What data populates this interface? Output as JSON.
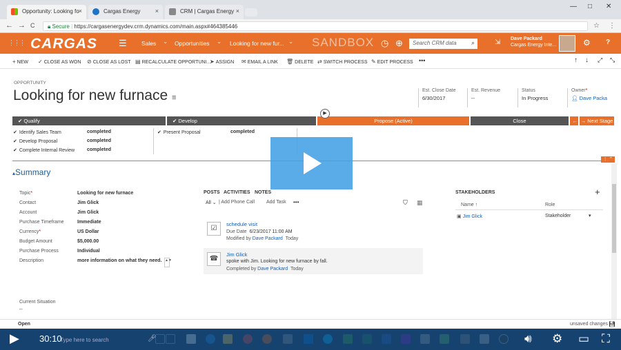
{
  "browser": {
    "tabs": [
      {
        "title": "Opportunity: Looking fo",
        "close": "×"
      },
      {
        "title": "Cargas Energy",
        "close": "×"
      },
      {
        "title": "CRM | Cargas Energy",
        "close": "×"
      }
    ],
    "secure_label": "Secure",
    "url": "https://cargasenergydev.crm.dynamics.com/main.aspx#464385446",
    "back": "←",
    "forward": "→",
    "reload": "C",
    "min": "—",
    "max": "□",
    "close": "✕",
    "star": "☆",
    "menu": "⋮"
  },
  "crmnav": {
    "logo": "CARGAS",
    "hamburger": "☰",
    "items": [
      "Sales",
      "Opportunities",
      "Looking for new fur..."
    ],
    "chevron": "⌄",
    "sandbox": "SANDBOX",
    "search_placeholder": "Search CRM data",
    "search_icon": "⌕",
    "user_name": "Dave Packard",
    "org_name": "Cargas Energy Inte...",
    "gear": "⚙",
    "help": "?",
    "clock": "◷",
    "plus": "⊕",
    "apps": "⋮⋮⋮"
  },
  "commands": [
    {
      "icon": "+",
      "label": "New"
    },
    {
      "icon": "✓",
      "label": "Close as Won"
    },
    {
      "icon": "⊘",
      "label": "Close as Lost"
    },
    {
      "icon": "▤",
      "label": "Recalculate Opportuni..."
    },
    {
      "icon": "➤",
      "label": "Assign"
    },
    {
      "icon": "✉",
      "label": "Email a Link"
    },
    {
      "icon": "🗑",
      "label": "Delete"
    },
    {
      "icon": "⇄",
      "label": "Switch Process"
    },
    {
      "icon": "✎",
      "label": "Edit Process"
    },
    {
      "icon": "•••",
      "label": ""
    }
  ],
  "header": {
    "entity": "OPPORTUNITY",
    "title": "Looking for new furnace",
    "fields": [
      {
        "label": "Est. Close Date",
        "value": "6/30/2017"
      },
      {
        "label": "Est. Revenue",
        "value": "--"
      },
      {
        "label": "Status",
        "value": "In Progress"
      },
      {
        "label": "Owner",
        "value": "Dave Packa"
      }
    ]
  },
  "process": {
    "stages": [
      "Qualify",
      "Develop",
      "Propose (Active)",
      "Close"
    ],
    "next_stage": "Next Stage",
    "qualify_steps": [
      {
        "name": "Identify Sales Team",
        "value": "completed"
      },
      {
        "name": "Develop Proposal",
        "value": "completed"
      },
      {
        "name": "Complete Internal Review",
        "value": "completed"
      }
    ],
    "develop_steps": [
      {
        "name": "Present Proposal",
        "value": "completed"
      }
    ]
  },
  "summary": {
    "title": "Summary",
    "fields": [
      {
        "label": "Topic",
        "value": "Looking for new furnace"
      },
      {
        "label": "Contact",
        "value": "Jim Glick"
      },
      {
        "label": "Account",
        "value": "Jim Glick"
      },
      {
        "label": "Purchase Timeframe",
        "value": "Immediate"
      },
      {
        "label": "Currency",
        "value": "US Dollar"
      },
      {
        "label": "Budget Amount",
        "value": "$5,000.00"
      },
      {
        "label": "Purchase Process",
        "value": "Individual"
      },
      {
        "label": "Description",
        "value": "more information on what they need."
      }
    ],
    "current_situation_label": "Current Situation",
    "current_situation_value": "--"
  },
  "activities": {
    "tabs": [
      "POSTS",
      "ACTIVITIES",
      "NOTES"
    ],
    "filter_all": "All",
    "add_phone": "Add Phone Call",
    "add_task": "Add Task",
    "more": "•••",
    "items": [
      {
        "title": "schedule visit",
        "line1_label": "Due Date",
        "line1_value": "6/23/2017 11:00 AM",
        "line2_label": "Modified by",
        "line2_person": "Dave Packard",
        "line2_when": "Today"
      },
      {
        "title": "Jim Glick",
        "line1_label": "",
        "line1_value": "spoke with Jim. Looking for new furnace by fall.",
        "line2_label": "Completed by",
        "line2_person": "Dave Packard",
        "line2_when": "Today"
      }
    ]
  },
  "stakeholders": {
    "title": "STAKEHOLDERS",
    "add": "+",
    "col_name": "Name",
    "col_role": "Role",
    "rows": [
      {
        "name": "Jim Glick",
        "role": "Stakeholder"
      }
    ]
  },
  "footer": {
    "status": "Open",
    "unsaved": "unsaved changes"
  },
  "taskbar": {
    "time": "30:10",
    "search": "Type here to search"
  },
  "colors": {
    "accent": "#e8702a",
    "stage_dark": "#555555",
    "link": "#1160b7",
    "play": "#43a0e6"
  }
}
